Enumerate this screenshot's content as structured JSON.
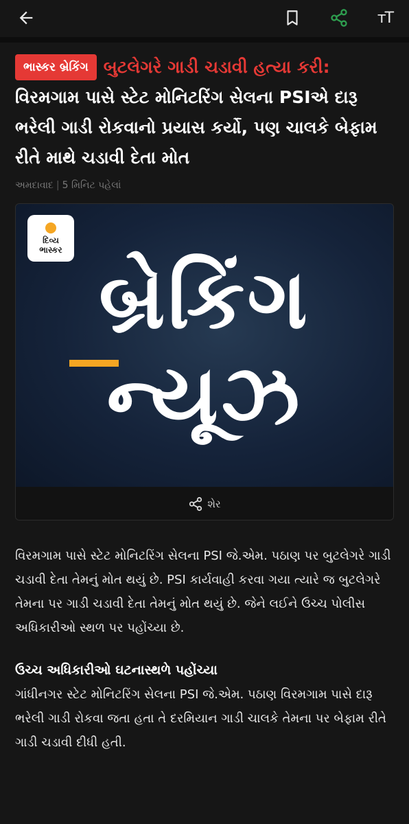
{
  "topbar": {
    "back_icon": "arrow-left-icon",
    "bookmark_icon": "bookmark-icon",
    "share_icon": "share-icon",
    "share_color": "#2e9e4f",
    "font_size_label": "тT"
  },
  "article": {
    "badge": "ભાસ્કર બ્રેકિંગ",
    "title_red": "બુટલેગરે ગાડી ચડાવી હત્યા કરી:",
    "title_white": "વિરમગામ પાસે સ્ટેટ મોનિટરિંગ સેલના PSIએ દારૂ ભરેલી ગાડી રોકવાનો પ્રયાસ કર્યો, પણ ચાલકે બેફામ રીતે માથે ચડાવી દેતા મોત",
    "location": "અમદાવાદ",
    "time": "5 મિનિટ પહેલાં",
    "colors": {
      "badge_bg": "#e53935",
      "accent": "#f5a623"
    }
  },
  "hero": {
    "logo_line1": "દિવ્ય",
    "logo_line2": "ભાસ્કર",
    "line1": "બ્રેકિંગ",
    "line2": "ન્યૂઝ"
  },
  "share": {
    "label": "શેર"
  },
  "body": {
    "para1": "વિરમગામ પાસે સ્ટેટ મોનિટરિંગ સેલના PSI જે.એમ. પઠાણ પર બુટલેગરે ગાડી ચડાવી દેતા તેમનું મોત થયું છે. PSI કાર્યવાહી કરવા ગયા ત્યારે જ બુટલેગરે તેમના પર ગાડી ચડાવી દેતા તેમનું મોત થયું છે. જેને લઈને ઉચ્ચ પોલીસ અધિકારીઓ સ્થળ પર પહોંચ્યા છે.",
    "section_heading": "ઉચ્ચ અધિકારીઓ ઘટનાસ્થળે પહોંચ્યા",
    "para2": "ગાંધીનગર સ્ટેટ મોનિટરિંગ સેલના PSI જે.એમ. પઠાણ વિરમગામ પાસે દારૂ ભરેલી ગાડી રોકવા જતા હતા તે દરમિયાન ગાડી ચાલકે તેમના પર બેફામ રીતે ગાડી ચડાવી દીધી હતી."
  }
}
